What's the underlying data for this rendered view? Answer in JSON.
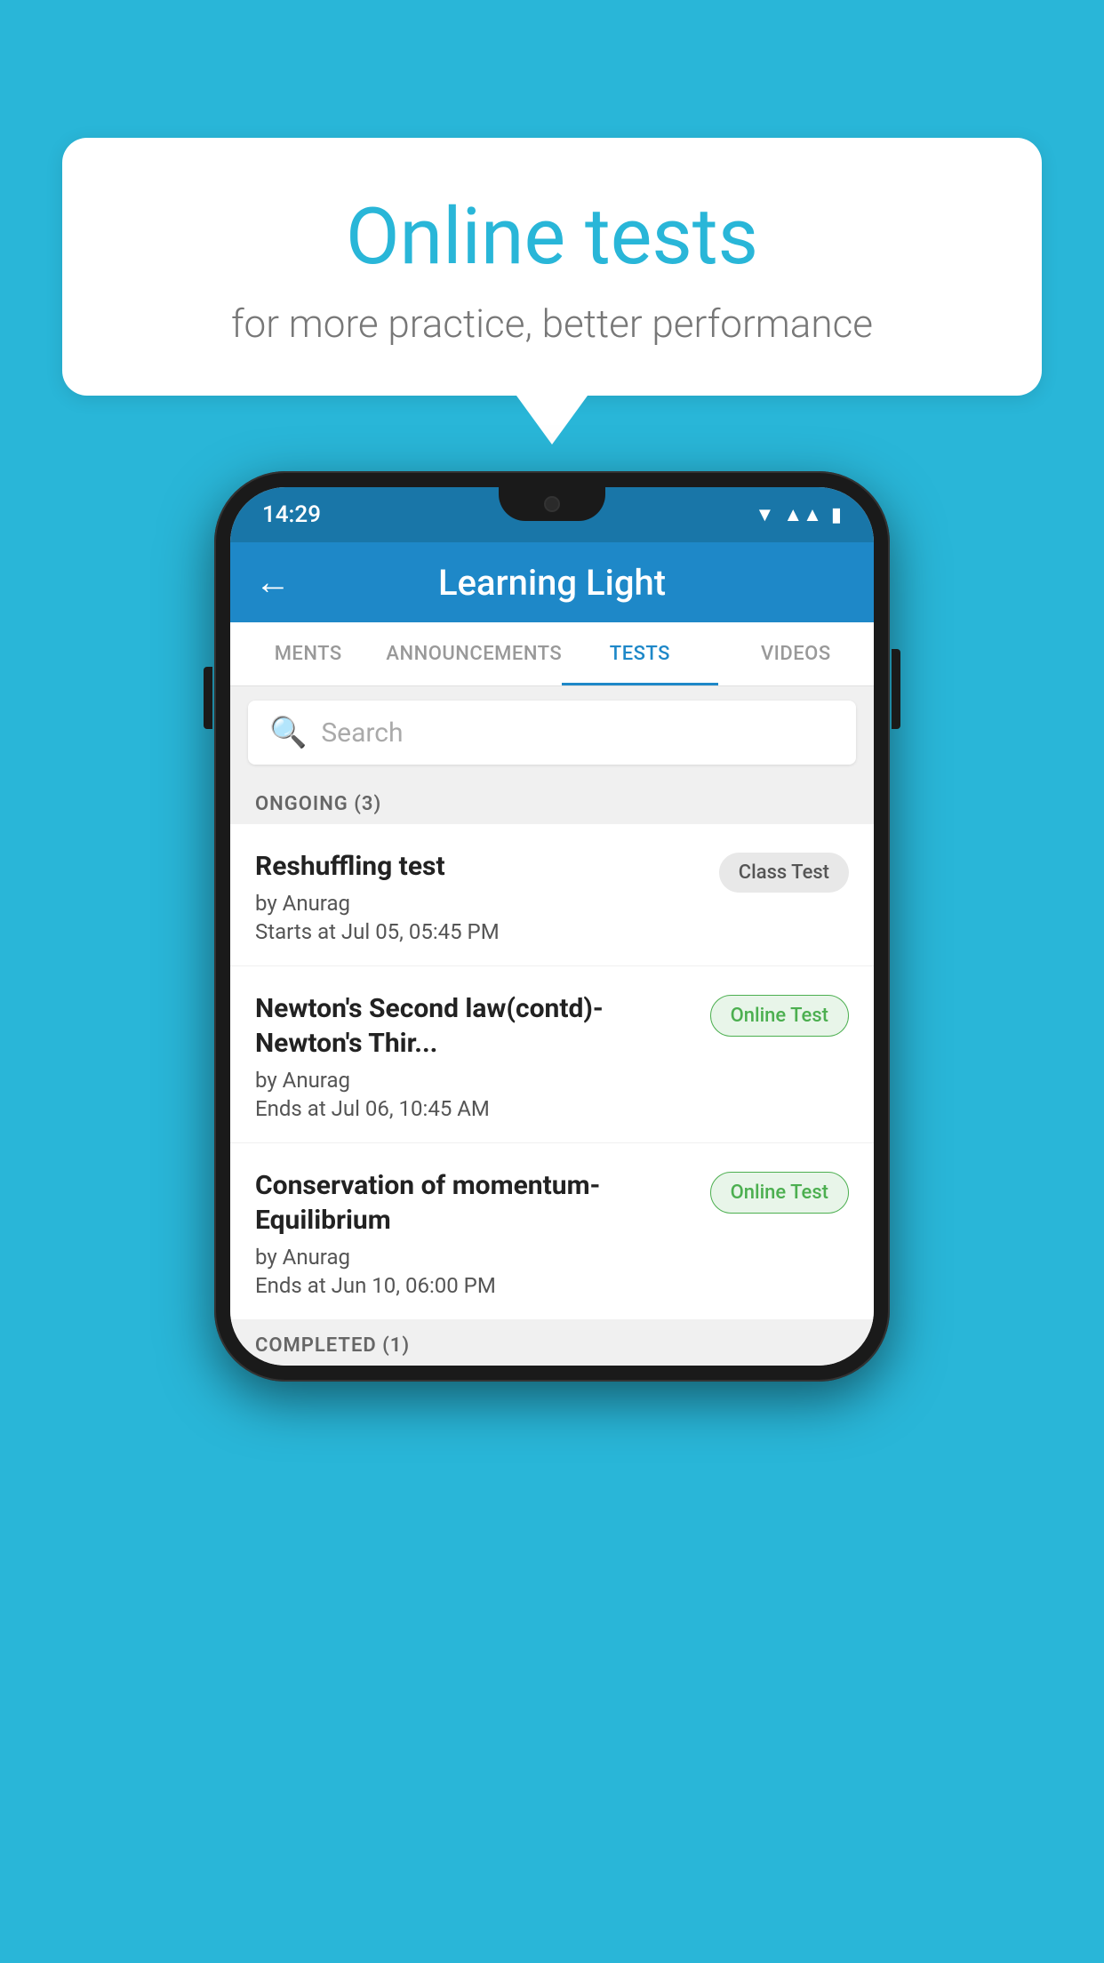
{
  "background_color": "#29b6d8",
  "speech_bubble": {
    "title": "Online tests",
    "subtitle": "for more practice, better performance"
  },
  "phone": {
    "status_bar": {
      "time": "14:29",
      "icons": [
        "wifi",
        "signal",
        "battery"
      ]
    },
    "app_header": {
      "back_label": "←",
      "title": "Learning Light"
    },
    "tabs": [
      {
        "label": "MENTS",
        "active": false
      },
      {
        "label": "ANNOUNCEMENTS",
        "active": false
      },
      {
        "label": "TESTS",
        "active": true
      },
      {
        "label": "VIDEOS",
        "active": false
      }
    ],
    "search": {
      "placeholder": "Search"
    },
    "sections": [
      {
        "header": "ONGOING (3)",
        "items": [
          {
            "name": "Reshuffling test",
            "author": "by Anurag",
            "date": "Starts at  Jul 05, 05:45 PM",
            "badge": "Class Test",
            "badge_type": "class"
          },
          {
            "name": "Newton's Second law(contd)-Newton's Thir...",
            "author": "by Anurag",
            "date": "Ends at  Jul 06, 10:45 AM",
            "badge": "Online Test",
            "badge_type": "online"
          },
          {
            "name": "Conservation of momentum-Equilibrium",
            "author": "by Anurag",
            "date": "Ends at  Jun 10, 06:00 PM",
            "badge": "Online Test",
            "badge_type": "online"
          }
        ]
      }
    ],
    "completed_section": {
      "header": "COMPLETED (1)"
    }
  }
}
